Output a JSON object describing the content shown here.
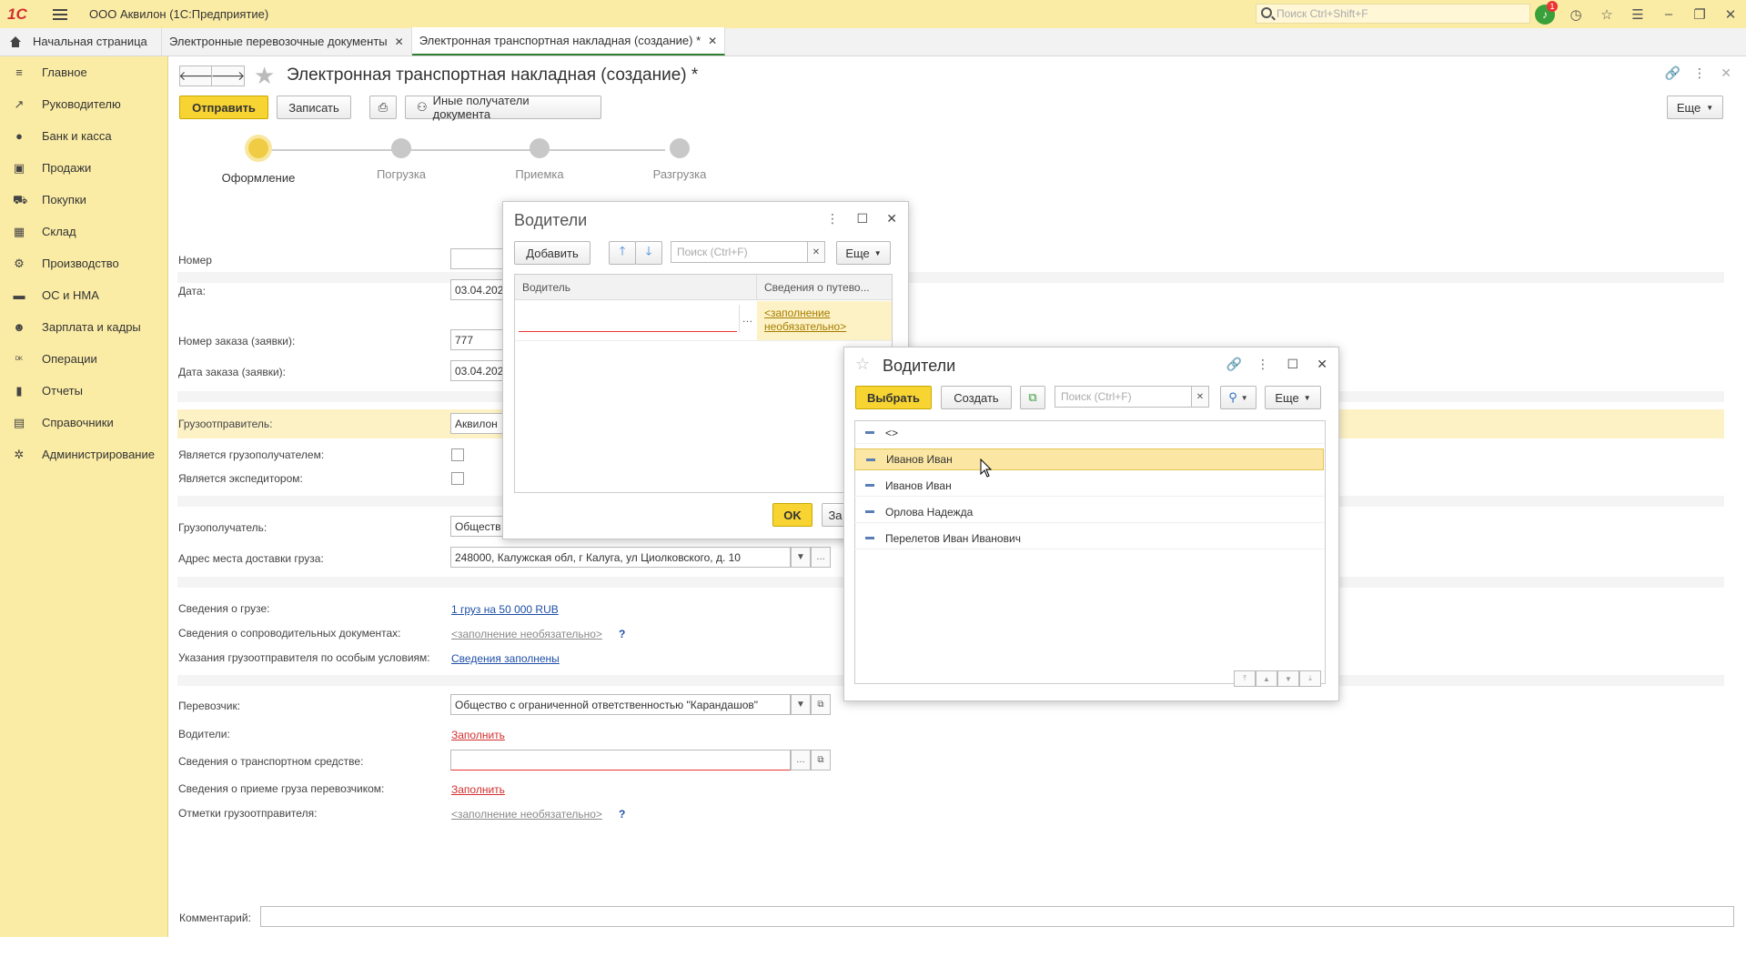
{
  "titlebar": {
    "logo": "1С",
    "app_title": "ООО Аквилон  (1С:Предприятие)",
    "search_placeholder": "Поиск Ctrl+Shift+F",
    "notifications_count": "1"
  },
  "tabs": {
    "home": "Начальная страница",
    "items": [
      {
        "label": "Электронные перевозочные документы"
      },
      {
        "label": "Электронная транспортная накладная (создание) *"
      }
    ]
  },
  "sidebar": {
    "items": [
      {
        "label": "Главное",
        "icon": "menu-icon"
      },
      {
        "label": "Руководителю",
        "icon": "trend-icon"
      },
      {
        "label": "Банк и касса",
        "icon": "coins-icon"
      },
      {
        "label": "Продажи",
        "icon": "bag-icon"
      },
      {
        "label": "Покупки",
        "icon": "cart-icon"
      },
      {
        "label": "Склад",
        "icon": "grid-icon"
      },
      {
        "label": "Производство",
        "icon": "factory-icon"
      },
      {
        "label": "ОС и НМА",
        "icon": "car-icon"
      },
      {
        "label": "Зарплата и кадры",
        "icon": "person-icon"
      },
      {
        "label": "Операции",
        "icon": "dt-kt-icon"
      },
      {
        "label": "Отчеты",
        "icon": "bar-chart-icon"
      },
      {
        "label": "Справочники",
        "icon": "book-icon"
      },
      {
        "label": "Администрирование",
        "icon": "gear-icon"
      }
    ]
  },
  "document": {
    "title": "Электронная транспортная накладная (создание) *",
    "toolbar": {
      "send": "Отправить",
      "save": "Записать",
      "other_recipients": "Иные получатели документа",
      "more": "Еще"
    },
    "steps": [
      {
        "label": "Оформление",
        "active": true
      },
      {
        "label": "Погрузка",
        "active": false
      },
      {
        "label": "Приемка",
        "active": false
      },
      {
        "label": "Разгрузка",
        "active": false
      }
    ],
    "fields": {
      "number_label": "Номер",
      "number_value": "",
      "date_label": "Дата:",
      "date_value": "03.04.202",
      "order_number_label": "Номер заказа (заявки):",
      "order_number_value": "777",
      "order_date_label": "Дата заказа (заявки):",
      "order_date_value": "03.04.202",
      "shipper_label": "Грузоотправитель:",
      "shipper_value": "Аквилон",
      "is_consignee_label": "Является грузополучателем:",
      "is_forwarder_label": "Является экспедитором:",
      "consignee_label": "Грузополучатель:",
      "consignee_value": "Обществ",
      "delivery_address_label": "Адрес места доставки груза:",
      "delivery_address_value": "248000, Калужская обл, г Калуга, ул Циолковского, д. 10",
      "cargo_info_label": "Сведения о грузе:",
      "cargo_info_value": "1 груз на 50 000 RUB",
      "docs_info_label": "Сведения о сопроводительных документах:",
      "docs_info_value": "<заполнение необязательно>",
      "special_label": "Указания грузоотправителя по особым условиям:",
      "special_value": "Сведения заполнены",
      "carrier_label": "Перевозчик:",
      "carrier_value": "Общество с ограниченной ответственностью \"Карандашов\"",
      "drivers_label": "Водители:",
      "drivers_value": "Заполнить",
      "vehicle_label": "Сведения о транспортном средстве:",
      "vehicle_value": "",
      "acceptance_label": "Сведения о приеме груза перевозчиком:",
      "acceptance_value": "Заполнить",
      "shipper_marks_label": "Отметки грузоотправителя:",
      "shipper_marks_value": "<заполнение необязательно>",
      "comment_label": "Комментарий:",
      "comment_value": ""
    }
  },
  "drivers_dialog": {
    "title": "Водители",
    "add": "Добавить",
    "search_placeholder": "Поиск (Ctrl+F)",
    "more": "Еще",
    "columns": [
      "Водитель",
      "Сведения о путево..."
    ],
    "row_link": "<заполнение необязательно>",
    "ok": "OK",
    "cancel": "За"
  },
  "select_dialog": {
    "title": "Водители",
    "select": "Выбрать",
    "create": "Создать",
    "search_placeholder": "Поиск (Ctrl+F)",
    "more": "Еще",
    "items": [
      {
        "label": "<>",
        "selected": false
      },
      {
        "label": "Иванов Иван",
        "selected": true
      },
      {
        "label": "Иванов Иван",
        "selected": false
      },
      {
        "label": "Орлова Надежда",
        "selected": false
      },
      {
        "label": "Перелетов Иван Иванович",
        "selected": false
      }
    ]
  },
  "colors": {
    "accent_yellow": "#fbeca5",
    "primary_button": "#f7d432",
    "link_blue": "#1f4fa8",
    "required_red": "#d32f2f"
  }
}
